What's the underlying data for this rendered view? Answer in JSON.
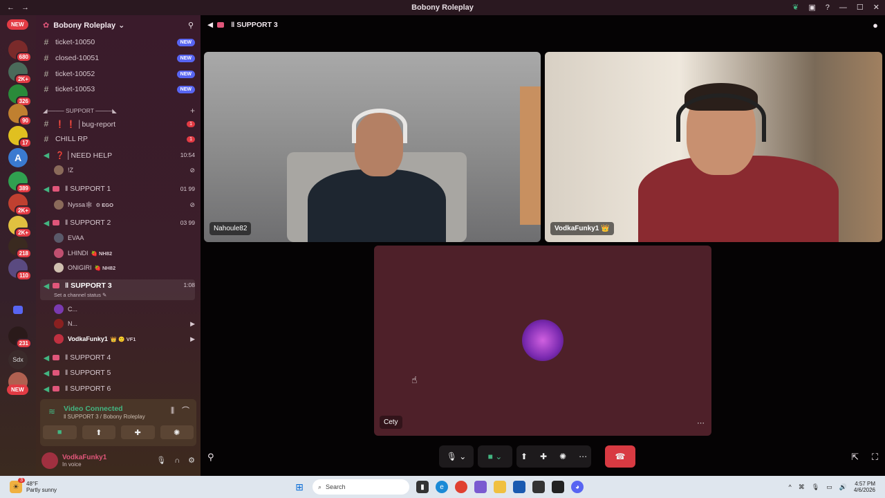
{
  "window": {
    "title": "Bobony Roleplay"
  },
  "rail": {
    "badges": [
      "680",
      "2K+",
      "326",
      "90",
      "17",
      "389",
      "2K+",
      "2K+",
      "218",
      "110",
      "231"
    ],
    "new_top": "NEW",
    "new_bottom": "NEW",
    "sdx_label": "Sdx"
  },
  "server": {
    "name": "Bobony Roleplay"
  },
  "channels": {
    "t1": {
      "label": "ticket-10050",
      "badge": "NEW"
    },
    "t2": {
      "label": "closed-10051",
      "badge": "NEW"
    },
    "t3": {
      "label": "ticket-10052",
      "badge": "NEW"
    },
    "t4": {
      "label": "ticket-10053",
      "badge": "NEW"
    },
    "category": "◢──── SUPPORT ────◣",
    "bug": {
      "label": "❗ ❗ │bug-report",
      "count": "1"
    },
    "chill": {
      "label": "CHILL RP",
      "count": "1"
    },
    "needhelp": {
      "label": "❓ │NEED HELP",
      "time": "10:54"
    },
    "needhelp_member": "!Z",
    "s1": {
      "label": "‖ SUPPORT 1",
      "meta": "01 99"
    },
    "s1_members": [
      {
        "name": "Nyssa🕸",
        "tag": "⚙ EGO"
      }
    ],
    "s2": {
      "label": "‖ SUPPORT 2",
      "meta": "03 99"
    },
    "s2_members": [
      {
        "name": "EVAA",
        "tag": ""
      },
      {
        "name": "LHINDI",
        "tag": "🍓 NH82"
      },
      {
        "name": "ONIGIRI",
        "tag": "🍓 NH82"
      }
    ],
    "s3": {
      "label": "‖ SUPPORT 3",
      "time": "1:08",
      "status": "Set a channel status ✎"
    },
    "s3_members": [
      {
        "name": "C...",
        "tag": ""
      },
      {
        "name": "N...",
        "tag": ""
      },
      {
        "name": "VodkaFunky1",
        "tag": "👑 🙂 VF1"
      }
    ],
    "s4": {
      "label": "‖ SUPPORT 4"
    },
    "s5": {
      "label": "‖ SUPPORT 5"
    },
    "s6": {
      "label": "‖ SUPPORT 6"
    }
  },
  "voice": {
    "status": "Video Connected",
    "location": "‖ SUPPORT 3 / Bobony Roleplay"
  },
  "user": {
    "name": "VodkaFunky1",
    "status": "In voice"
  },
  "main": {
    "channel_title": "‖ SUPPORT 3",
    "tiles": [
      {
        "name": "Nahoule82"
      },
      {
        "name": "VodkaFunky1 👑"
      },
      {
        "name": "Cety"
      }
    ]
  },
  "taskbar": {
    "weather_temp": "48°F",
    "weather_desc": "Partly sunny",
    "weather_badge": "3",
    "search_placeholder": "Search",
    "time": "4:57 PM",
    "date": "4/6/2026"
  },
  "colors": {
    "accent_green": "#43b581",
    "hangup_red": "#d83a42",
    "new_badge": "#5865f2"
  }
}
